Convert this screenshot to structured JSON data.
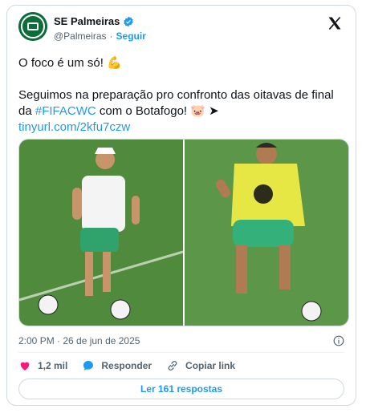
{
  "account": {
    "display_name": "SE Palmeiras",
    "handle": "@Palmeiras",
    "separator": "·",
    "follow_label": "Seguir"
  },
  "post": {
    "line1": "O foco é um só! 💪",
    "line2_prefix": "Seguimos na preparação pro confronto das oitavas de final da ",
    "hashtag": "#FIFACWC",
    "line2_suffix": " com o Botafogo! 🐷 ➤",
    "link": "tinyurl.com/2kfu7czw"
  },
  "meta": {
    "timestamp": "2:00 PM · 26 de jun de 2025"
  },
  "actions": {
    "likes": "1,2 mil",
    "reply_label": "Responder",
    "copy_link_label": "Copiar link"
  },
  "replies_button": "Ler 161 respostas",
  "colors": {
    "accent": "#1d9bf0",
    "like": "#f91880",
    "club_green": "#0a6d3a"
  },
  "icons": [
    "palmeiras-logo",
    "verified-badge-icon",
    "x-logo-icon",
    "info-icon",
    "heart-icon",
    "reply-bubble-icon",
    "link-icon"
  ]
}
